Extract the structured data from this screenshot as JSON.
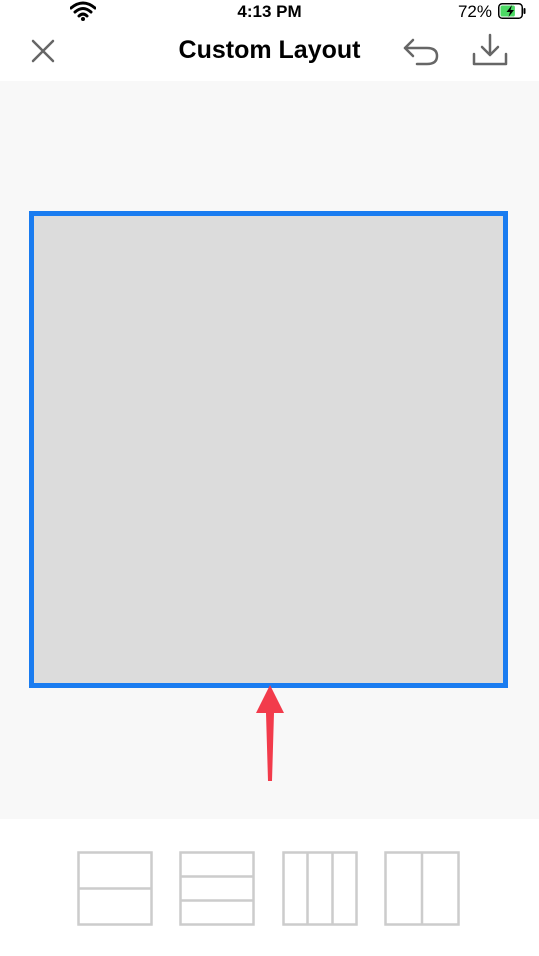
{
  "status_bar": {
    "time": "4:13 PM",
    "battery_percent": "72%",
    "battery_level": 0.72,
    "icons": [
      "wifi-icon",
      "battery-charging-icon"
    ]
  },
  "nav": {
    "title": "Custom Layout",
    "icons": [
      "close-icon",
      "undo-icon",
      "download-icon"
    ]
  },
  "canvas": {
    "selected_cell_color": "#1a7cf0",
    "cell_fill": "#dcdcdc",
    "annotation_arrow_color": "#f23b4b"
  },
  "layout_options": [
    {
      "name": "layout-two-rows",
      "icon": "two-rows-icon"
    },
    {
      "name": "layout-three-rows",
      "icon": "three-rows-icon"
    },
    {
      "name": "layout-three-columns",
      "icon": "three-columns-icon"
    },
    {
      "name": "layout-two-columns",
      "icon": "two-columns-icon"
    }
  ]
}
